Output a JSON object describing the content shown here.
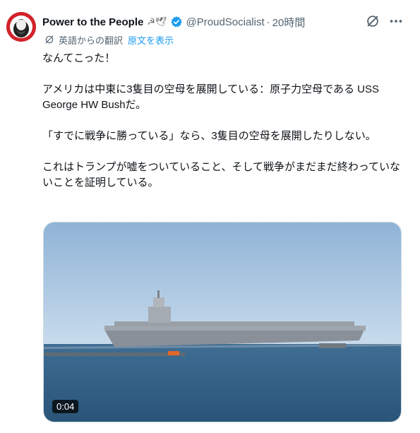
{
  "tweet": {
    "display_name": "Power to the People",
    "name_emoji": "☭🕊",
    "handle": "@ProudSocialist",
    "separator": "·",
    "time": "20時間",
    "translated_label": "英語からの翻訳",
    "show_original": "原文を表示",
    "paragraphs": [
      "なんてこった！",
      "アメリカは中東に3隻目の空母を展開している：原子力空母である USS George HW Bushだ。",
      "「すでに戦争に勝っている」なら、3隻目の空母を展開したりしない。",
      "これはトランプが嘘をついていること、そして戦争がまだまだ終わっていないことを証明している。"
    ],
    "video": {
      "duration": "0:04"
    }
  },
  "icons": {
    "verified": "verified-badge-icon",
    "grok": "grok-icon",
    "more": "more-icon",
    "translate": "translate-icon"
  },
  "colors": {
    "accent": "#1d9bf0",
    "text": "#0f1419",
    "secondary": "#536471",
    "avatar_bg": "#d1232a"
  }
}
